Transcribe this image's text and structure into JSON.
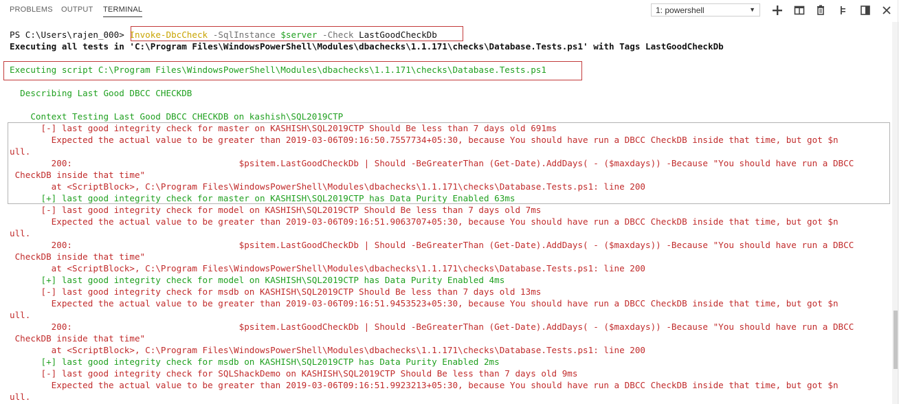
{
  "panel": {
    "tabs": [
      "PROBLEMS",
      "OUTPUT",
      "TERMINAL"
    ],
    "active_tab": "TERMINAL",
    "terminal_select": "1: powershell",
    "toolbar_icons": [
      "plus-icon",
      "split-icon",
      "trash-icon",
      "maximize-icon",
      "layout-icon",
      "close-icon"
    ]
  },
  "prompt": {
    "ps": "PS C:\\Users\\rajen_000>",
    "cmd_name": "Invoke-DbcCheck",
    "p1": "-SqlInstance",
    "var": "$server",
    "p2": "-Check",
    "arg": "LastGoodCheckDb"
  },
  "lines": [
    "Executing all tests in 'C:\\Program Files\\WindowsPowerShell\\Modules\\dbachecks\\1.1.171\\checks\\Database.Tests.ps1' with Tags LastGoodCheckDb",
    "Executing script C:\\Program Files\\WindowsPowerShell\\Modules\\dbachecks\\1.1.171\\checks\\Database.Tests.ps1",
    "  Describing Last Good DBCC CHECKDB",
    "    Context Testing Last Good DBCC CHECKDB on kashish\\SQL2019CTP",
    "      [-] last good integrity check for master on KASHISH\\SQL2019CTP Should Be less than 7 days old 691ms",
    "        Expected the actual value to be greater than 2019-03-06T09:16:50.7557734+05:30, because You should have run a DBCC CheckDB inside that time, but got $n",
    "ull.",
    "        200:                                $psitem.LastGoodCheckDb | Should -BeGreaterThan (Get-Date).AddDays( - ($maxdays)) -Because \"You should have run a DBCC",
    " CheckDB inside that time\"",
    "        at <ScriptBlock>, C:\\Program Files\\WindowsPowerShell\\Modules\\dbachecks\\1.1.171\\checks\\Database.Tests.ps1: line 200",
    "      [+] last good integrity check for master on KASHISH\\SQL2019CTP has Data Purity Enabled 63ms",
    "      [-] last good integrity check for model on KASHISH\\SQL2019CTP Should Be less than 7 days old 7ms",
    "        Expected the actual value to be greater than 2019-03-06T09:16:51.9063707+05:30, because You should have run a DBCC CheckDB inside that time, but got $n",
    "ull.",
    "        200:                                $psitem.LastGoodCheckDb | Should -BeGreaterThan (Get-Date).AddDays( - ($maxdays)) -Because \"You should have run a DBCC",
    " CheckDB inside that time\"",
    "        at <ScriptBlock>, C:\\Program Files\\WindowsPowerShell\\Modules\\dbachecks\\1.1.171\\checks\\Database.Tests.ps1: line 200",
    "      [+] last good integrity check for model on KASHISH\\SQL2019CTP has Data Purity Enabled 4ms",
    "      [-] last good integrity check for msdb on KASHISH\\SQL2019CTP Should Be less than 7 days old 13ms",
    "        Expected the actual value to be greater than 2019-03-06T09:16:51.9453523+05:30, because You should have run a DBCC CheckDB inside that time, but got $n",
    "ull.",
    "        200:                                $psitem.LastGoodCheckDb | Should -BeGreaterThan (Get-Date).AddDays( - ($maxdays)) -Because \"You should have run a DBCC",
    " CheckDB inside that time\"",
    "        at <ScriptBlock>, C:\\Program Files\\WindowsPowerShell\\Modules\\dbachecks\\1.1.171\\checks\\Database.Tests.ps1: line 200",
    "      [+] last good integrity check for msdb on KASHISH\\SQL2019CTP has Data Purity Enabled 2ms",
    "      [-] last good integrity check for SQLShackDemo on KASHISH\\SQL2019CTP Should Be less than 7 days old 9ms",
    "        Expected the actual value to be greater than 2019-03-06T09:16:51.9923213+05:30, because You should have run a DBCC CheckDB inside that time, but got $n",
    "ull."
  ],
  "colors": {
    "pass": "#20a020",
    "fail": "#c12b2b",
    "highlight_box": "#c23a3a",
    "cmdlet": "#c8a400"
  }
}
